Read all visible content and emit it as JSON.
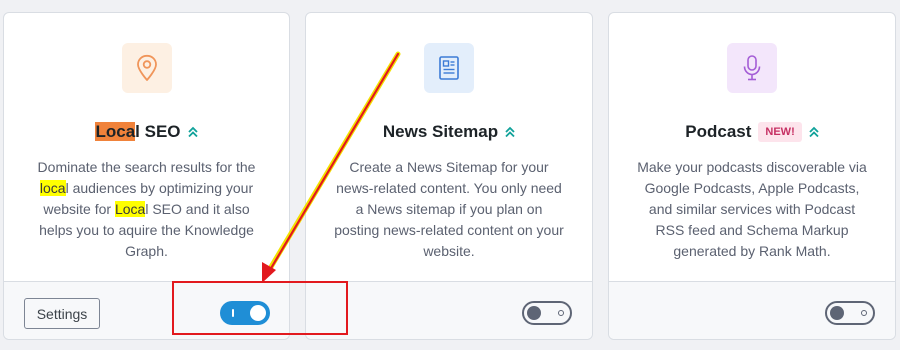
{
  "modules": [
    {
      "id": "local-seo",
      "title_highlight": "Loca",
      "title_rest": "l SEO",
      "icon": "map-pin-icon",
      "icon_color": "#f0955a",
      "icon_bg": "#fdf0e3",
      "description_parts": [
        "Dominate the search results for the ",
        "loca",
        "l audiences by optimizing your website for ",
        "Loca",
        "l SEO and it also helps you to aquire the Knowledge Graph."
      ],
      "settings_label": "Settings",
      "enabled": true
    },
    {
      "id": "news-sitemap",
      "title": "News Sitemap",
      "icon": "newspaper-icon",
      "icon_color": "#3c7bd6",
      "icon_bg": "#e3eefb",
      "description": "Create a News Sitemap for your news-related content. You only need a News sitemap if you plan on posting news-related content on your website.",
      "enabled": false
    },
    {
      "id": "podcast",
      "title": "Podcast",
      "badge": "NEW!",
      "icon": "microphone-icon",
      "icon_color": "#a45dd6",
      "icon_bg": "#f3e6fb",
      "description": "Make your podcasts discoverable via Google Podcasts, Apple Podcasts, and similar services with Podcast RSS feed and Schema Markup generated by Rank Math.",
      "enabled": false
    }
  ],
  "colors": {
    "accent": "#1f8ed6",
    "chevron": "#10a29a",
    "annotation": "#e2191e"
  }
}
